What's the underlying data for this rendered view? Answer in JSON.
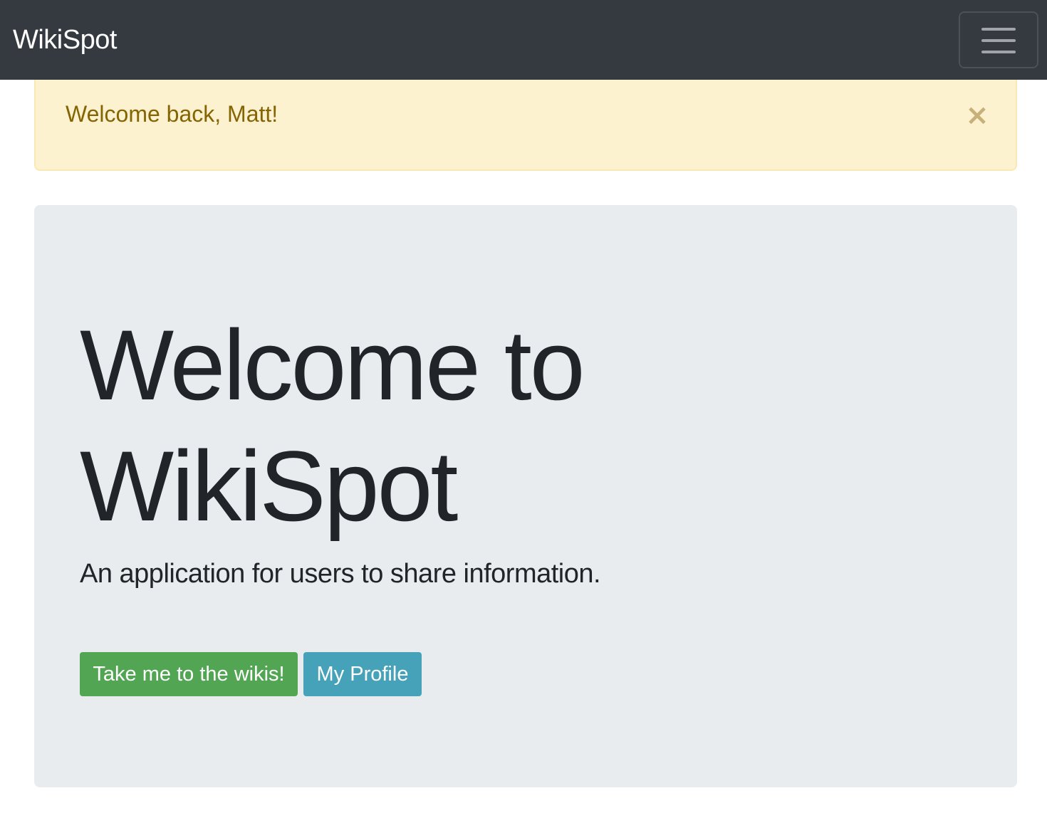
{
  "navbar": {
    "brand": "WikiSpot",
    "toggler_icon": "hamburger-menu-icon"
  },
  "alert": {
    "message": "Welcome back, Matt!",
    "close_label": "×",
    "close_icon": "close-icon"
  },
  "hero": {
    "title": "Welcome to WikiSpot",
    "lead": "An application for users to share information.",
    "primary_button": "Take me to the wikis!",
    "secondary_button": "My Profile"
  },
  "colors": {
    "navbar_bg": "#343a40",
    "alert_bg": "#fdf2cf",
    "alert_text": "#856404",
    "jumbotron_bg": "#e9ecef",
    "success": "#52a552",
    "info": "#46a2b8"
  }
}
